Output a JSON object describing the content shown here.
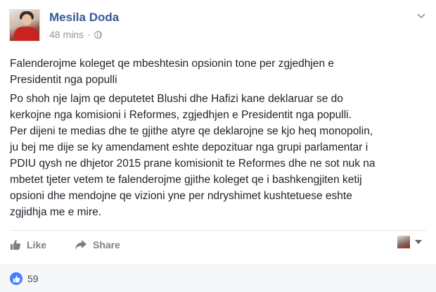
{
  "post": {
    "author": "Mesila Doda",
    "time": "48 mins",
    "separator": "·",
    "privacy_icon": "globe-icon",
    "paragraph_1": "Falenderojme koleget qe mbeshtesin opsionin tone per zgjedhjen e\nPresidentit nga populli",
    "paragraph_2": "Po shoh nje lajm qe deputetet Blushi dhe Hafizi kane deklaruar se do\nkerkojne nga komisioni i Reformes, zgjedhjen e Presidentit nga populli.\nPer dijeni te medias dhe te gjithe atyre qe deklarojne se kjo heq monopolin,\nju bej me dije se ky amendament eshte depozituar nga grupi parlamentar i\nPDIU qysh ne dhjetor 2015 prane komisionit te Reformes dhe ne sot nuk na\nmbetet tjeter vetem te falenderojme gjithe koleget qe i bashkengjiten ketij\nopsioni dhe mendojne qe vizioni yne per ndryshimet kushtetuese eshte\nzgjidhja me e mire."
  },
  "actions": {
    "like_label": "Like",
    "share_label": "Share"
  },
  "reactions": {
    "like_count": "59"
  },
  "colors": {
    "author": "#365899",
    "meta": "#90949c",
    "like_badge": "#4080ff"
  }
}
